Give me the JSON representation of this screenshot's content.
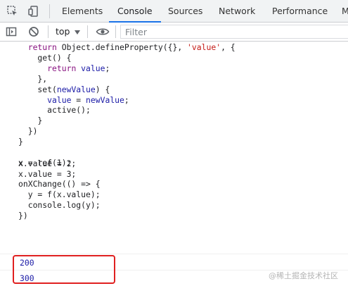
{
  "tabs": [
    {
      "label": "Elements"
    },
    {
      "label": "Console"
    },
    {
      "label": "Sources"
    },
    {
      "label": "Network"
    },
    {
      "label": "Performance"
    },
    {
      "label": "M"
    }
  ],
  "active_tab": "Console",
  "toolbar": {
    "context": "top",
    "filter_placeholder": "Filter"
  },
  "code_block_1": [
    "  return Object.defineProperty({}, 'value', {",
    "    get() {",
    "      return value;",
    "    },",
    "    set(newValue) {",
    "      value = newValue;",
    "      active();",
    "    }",
    "  })",
    "}",
    "",
    "x = ref(1);",
    "",
    "onXChange(() => {",
    "  y = f(x.value);",
    "  console.log(y);",
    "})"
  ],
  "code_block_2": [
    "x.value = 2;",
    "x.value = 3;"
  ],
  "outputs": [
    "200",
    "300"
  ],
  "watermark": "@稀土掘金技术社区",
  "colors": {
    "accent": "#1a73e8",
    "highlight_box": "#e02020",
    "keyword": "#881280",
    "string": "#c41a16",
    "variable": "#1a1aa6"
  }
}
